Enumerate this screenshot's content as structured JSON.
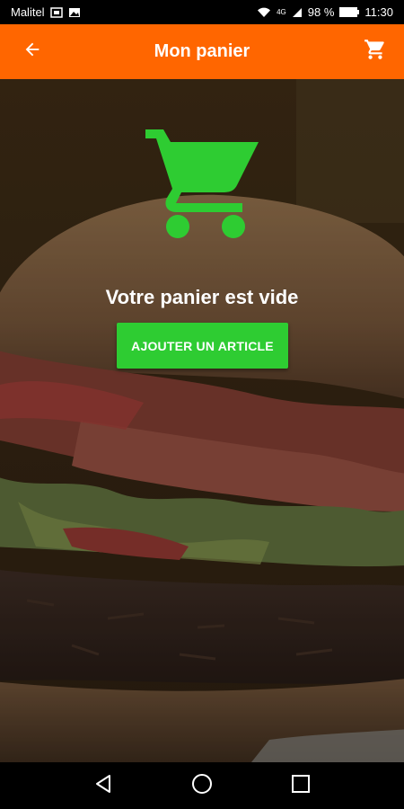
{
  "status_bar": {
    "carrier": "Malitel",
    "network": "4G",
    "battery": "98 %",
    "time": "11:30"
  },
  "app_bar": {
    "title": "Mon panier"
  },
  "cart": {
    "empty_message": "Votre panier est vide",
    "add_button_label": "AJOUTER UN ARTICLE"
  },
  "colors": {
    "app_bar": "#FF6600",
    "accent_green": "#2ECC32"
  },
  "icons": {
    "back": "arrow-left-icon",
    "cart": "shopping-cart-icon",
    "empty_cart": "shopping-cart-icon",
    "nav_back": "triangle-back-icon",
    "nav_home": "circle-home-icon",
    "nav_recents": "square-recents-icon"
  }
}
